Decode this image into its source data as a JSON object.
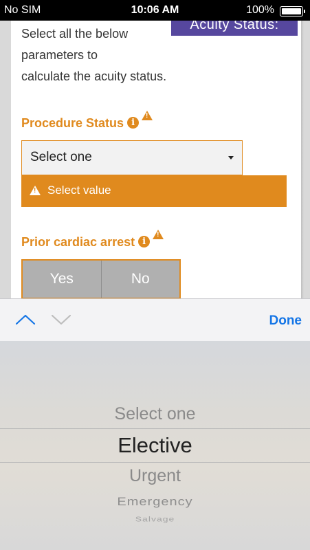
{
  "status_bar": {
    "carrier": "No SIM",
    "time": "10:06 AM",
    "battery": "100%"
  },
  "page": {
    "acuity_badge": "Acuity Status:",
    "intro": {
      "line1": "Select all the below",
      "line2": "parameters to",
      "line3": "calculate the acuity status."
    },
    "procedure_status": {
      "label": "Procedure Status",
      "selected": "Select one",
      "error": "Select value"
    },
    "prior_cardiac_arrest": {
      "label": "Prior cardiac arrest",
      "options": [
        "Yes",
        "No"
      ]
    }
  },
  "toolbar": {
    "done_label": "Done"
  },
  "picker": {
    "options": [
      "Select one",
      "Elective",
      "Urgent",
      "Emergency",
      "Salvage"
    ],
    "selected_index": 1
  },
  "colors": {
    "accent": "#e08a1e",
    "badge": "#56479e",
    "done": "#1475e6"
  }
}
